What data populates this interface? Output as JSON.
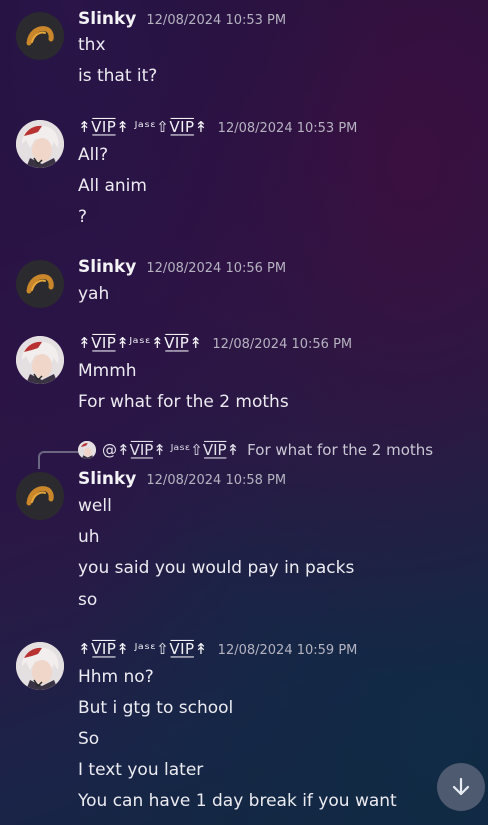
{
  "messages": [
    {
      "author": "Slinky",
      "timestamp": "12/08/2024 10:53 PM",
      "lines": [
        "thx",
        "is that it?"
      ]
    },
    {
      "author": "↟V̲̅I̲̅P̲̅↟ ᴶᵃˢᵋ⇧V̲̅I̲̅P̲̅↟",
      "timestamp": "12/08/2024 10:53 PM",
      "lines": [
        "All?",
        "All anim",
        "?"
      ]
    },
    {
      "author": "Slinky",
      "timestamp": "12/08/2024 10:56 PM",
      "lines": [
        "yah"
      ]
    },
    {
      "author": "↟V̲̅I̲̅P̲̅↟ᴶᵃˢᵋ↟V̲̅I̲̅P̲̅↟",
      "timestamp": "12/08/2024 10:56 PM",
      "lines": [
        "Mmmh",
        "For what for the 2 moths"
      ]
    },
    {
      "reply": {
        "mention": "@↟V̲̅I̲̅P̲̅↟ ᴶᵃˢᵋ⇧V̲̅I̲̅P̲̅↟",
        "quoted": "For what for the 2 moths"
      },
      "author": "Slinky",
      "timestamp": "12/08/2024 10:58 PM",
      "lines": [
        "well",
        "uh",
        "you said you would pay in packs",
        "so"
      ]
    },
    {
      "author": "↟V̲̅I̲̅P̲̅↟ ᴶᵃˢᵋ⇧V̲̅I̲̅P̲̅↟",
      "timestamp": "12/08/2024 10:59 PM",
      "lines": [
        "Hhm no?",
        "But i gtg to school",
        "So",
        "I text you later",
        "You can have 1 day break if you want"
      ]
    }
  ],
  "icons": {
    "slinky_avatar": "orange-curl-icon",
    "vip_avatar": "anime-character-avatar",
    "scroll_button": "arrow-down-icon"
  },
  "colors": {
    "username": "#f3f3f6",
    "timestamp": "#b5b3c0",
    "scroll_button": "#4d5a6f"
  }
}
